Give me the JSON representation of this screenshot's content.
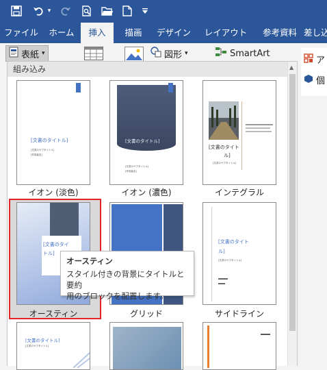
{
  "quick_access": {
    "save_icon": "save-icon",
    "undo_icon": "undo-icon",
    "redo_icon": "redo-icon",
    "print_preview_icon": "print-preview-icon",
    "open_icon": "open-folder-icon",
    "new_icon": "new-document-icon",
    "customize_icon": "customize-dropdown-icon"
  },
  "tabs": [
    "ファイル",
    "ホーム",
    "挿入",
    "描画",
    "デザイン",
    "レイアウト",
    "参考資料",
    "差し込"
  ],
  "active_tab": "挿入",
  "ribbon": {
    "cover_page": "表紙",
    "shapes": "図形",
    "smartart": "SmartArt",
    "addin_partial": "アド",
    "item_partial": "個"
  },
  "gallery": {
    "section": "組み込み",
    "items": [
      {
        "name": "イオン (淡色)",
        "title": "[文書のタイトル]",
        "subtitle": "[文書のサブタイトル]",
        "author": "[作成者名]"
      },
      {
        "name": "イオン (濃色)",
        "title": "[文書のタイトル]",
        "subtitle": "[文書のサブタイトル]",
        "author": "[作成者名]"
      },
      {
        "name": "インテグラル",
        "title_line1": "[文書のタイト",
        "title_line2": "ル]",
        "subtitle": "[文書のサブタイトル]"
      },
      {
        "name": "オースティン",
        "title_line1": "[文書のタイ",
        "title_line2": "トル]"
      },
      {
        "name": "グリッド"
      },
      {
        "name": "サイドライン",
        "title_line1": "[文書のタイト",
        "title_line2": "ル]",
        "subtitle": "[文書のサブタイトル]"
      },
      {
        "title": "[文書のタイトル]",
        "subtitle": "[文書のサブタイトル]"
      },
      {},
      {}
    ]
  },
  "tooltip": {
    "title": "オースティン",
    "line1": "スタイル付きの背景にタイトルと要約",
    "line2": "用のブロックを配置します。"
  },
  "colors": {
    "ribbon_blue": "#2b579a",
    "selection_red": "#e4232b",
    "accent_blue": "#4472c4"
  }
}
